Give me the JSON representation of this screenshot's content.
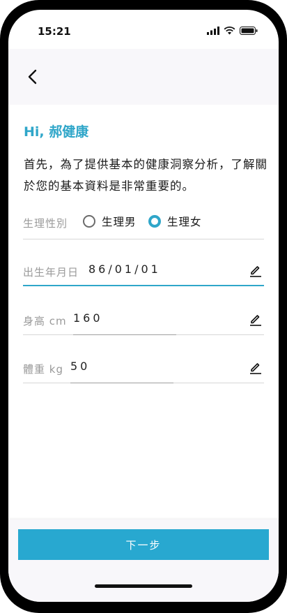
{
  "status_bar": {
    "time": "15:21"
  },
  "header": {
    "back_icon": "chevron-left-icon"
  },
  "greeting": "Hi, 郝健康",
  "intro": "首先，為了提供基本的健康洞察分析，了解關於您的基本資料是非常重要的。",
  "form": {
    "gender": {
      "label": "生理性別",
      "options": [
        "生理男",
        "生理女"
      ],
      "selected": "生理女"
    },
    "birthdate": {
      "label": "出生年月日",
      "value": "86/01/01"
    },
    "height": {
      "label": "身高 cm",
      "value": "160"
    },
    "weight": {
      "label": "體重 kg",
      "value": "50"
    }
  },
  "footer": {
    "next_label": "下一步"
  },
  "colors": {
    "accent": "#2fa6c9",
    "button": "#28a8d0",
    "label": "#9a9a9a"
  }
}
